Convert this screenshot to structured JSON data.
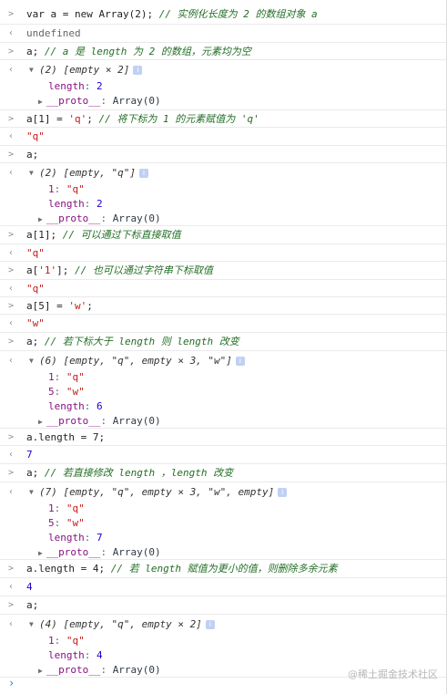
{
  "entries": [
    {
      "input": "var a = new Array(2);",
      "comment": "// 实例化长度为 2 的数组对象 a"
    },
    {
      "output": "undefined"
    },
    {
      "input": "a;",
      "comment": "// a 是 length 为 2 的数组，元素均为空"
    },
    {
      "preview": "(2) [empty × 2]",
      "props": [
        {
          "key": "length",
          "value": "2"
        }
      ],
      "proto": "__proto__",
      "proto_value": "Array(0)"
    },
    {
      "input_pre": "a[1] = ",
      "input_str": "'q'",
      "input_post": ";",
      "comment": "// 将下标为 1 的元素赋值为 'q'"
    },
    {
      "output_str": "\"q\""
    },
    {
      "input": "a;"
    },
    {
      "preview": "(2) [empty, \"q\"]",
      "props": [
        {
          "key": "1",
          "value": "\"q\""
        },
        {
          "key": "length",
          "value": "2"
        }
      ],
      "proto": "__proto__",
      "proto_value": "Array(0)"
    },
    {
      "input": "a[1];",
      "comment": "// 可以通过下标直接取值"
    },
    {
      "output_str": "\"q\""
    },
    {
      "input_pre": "a[",
      "input_str": "'1'",
      "input_post": "];",
      "comment": "// 也可以通过字符串下标取值"
    },
    {
      "output_str": "\"q\""
    },
    {
      "input_pre": "a[5] = ",
      "input_str": "'w'",
      "input_post": ";"
    },
    {
      "output_str": "\"w\""
    },
    {
      "input": "a;",
      "comment": "// 若下标大于 length 则 length 改变"
    },
    {
      "preview": "(6) [empty, \"q\", empty × 3, \"w\"]",
      "props": [
        {
          "key": "1",
          "value": "\"q\""
        },
        {
          "key": "5",
          "value": "\"w\""
        },
        {
          "key": "length",
          "value": "6"
        }
      ],
      "proto": "__proto__",
      "proto_value": "Array(0)"
    },
    {
      "input": "a.length = 7;"
    },
    {
      "output_num": "7"
    },
    {
      "input": "a;",
      "comment": "// 若直接修改 length ，length 改变"
    },
    {
      "preview": "(7) [empty, \"q\", empty × 3, \"w\", empty]",
      "props": [
        {
          "key": "1",
          "value": "\"q\""
        },
        {
          "key": "5",
          "value": "\"w\""
        },
        {
          "key": "length",
          "value": "7"
        }
      ],
      "proto": "__proto__",
      "proto_value": "Array(0)"
    },
    {
      "input": "a.length = 4;",
      "comment": "// 若 length 赋值为更小的值，则删除多余元素"
    },
    {
      "output_num": "4"
    },
    {
      "input": "a;"
    },
    {
      "preview": "(4) [empty, \"q\", empty × 2]",
      "props": [
        {
          "key": "1",
          "value": "\"q\""
        },
        {
          "key": "length",
          "value": "4"
        }
      ],
      "proto": "__proto__",
      "proto_value": "Array(0)"
    }
  ],
  "icons": {
    "input_prompt": ">",
    "output_prompt": "‹",
    "expanded": "▼",
    "collapsed": "▶",
    "info": "i",
    "bottom_prompt": "›"
  },
  "watermark": "@稀土掘金技术社区"
}
